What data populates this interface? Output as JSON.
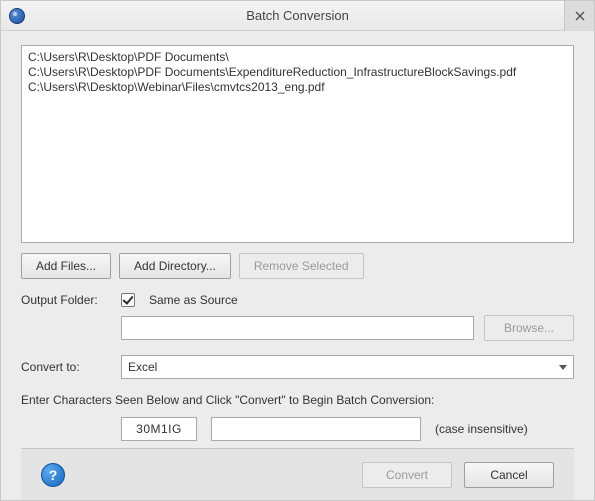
{
  "title": "Batch Conversion",
  "files": [
    "C:\\Users\\R\\Desktop\\PDF Documents\\",
    "C:\\Users\\R\\Desktop\\PDF Documents\\ExpenditureReduction_InfrastructureBlockSavings.pdf",
    "C:\\Users\\R\\Desktop\\Webinar\\Files\\cmvtcs2013_eng.pdf"
  ],
  "buttons": {
    "add_files": "Add Files...",
    "add_directory": "Add Directory...",
    "remove_selected": "Remove Selected",
    "browse": "Browse...",
    "convert": "Convert",
    "cancel": "Cancel"
  },
  "labels": {
    "output_folder": "Output Folder:",
    "same_as_source": "Same as Source",
    "convert_to": "Convert to:",
    "instruction": "Enter Characters Seen Below and Click \"Convert\" to Begin Batch Conversion:",
    "case_note": "(case insensitive)"
  },
  "output_folder": {
    "same_as_source": true,
    "path": ""
  },
  "convert_to": {
    "selected": "Excel"
  },
  "captcha": {
    "display": "30M1IG",
    "entry": ""
  }
}
